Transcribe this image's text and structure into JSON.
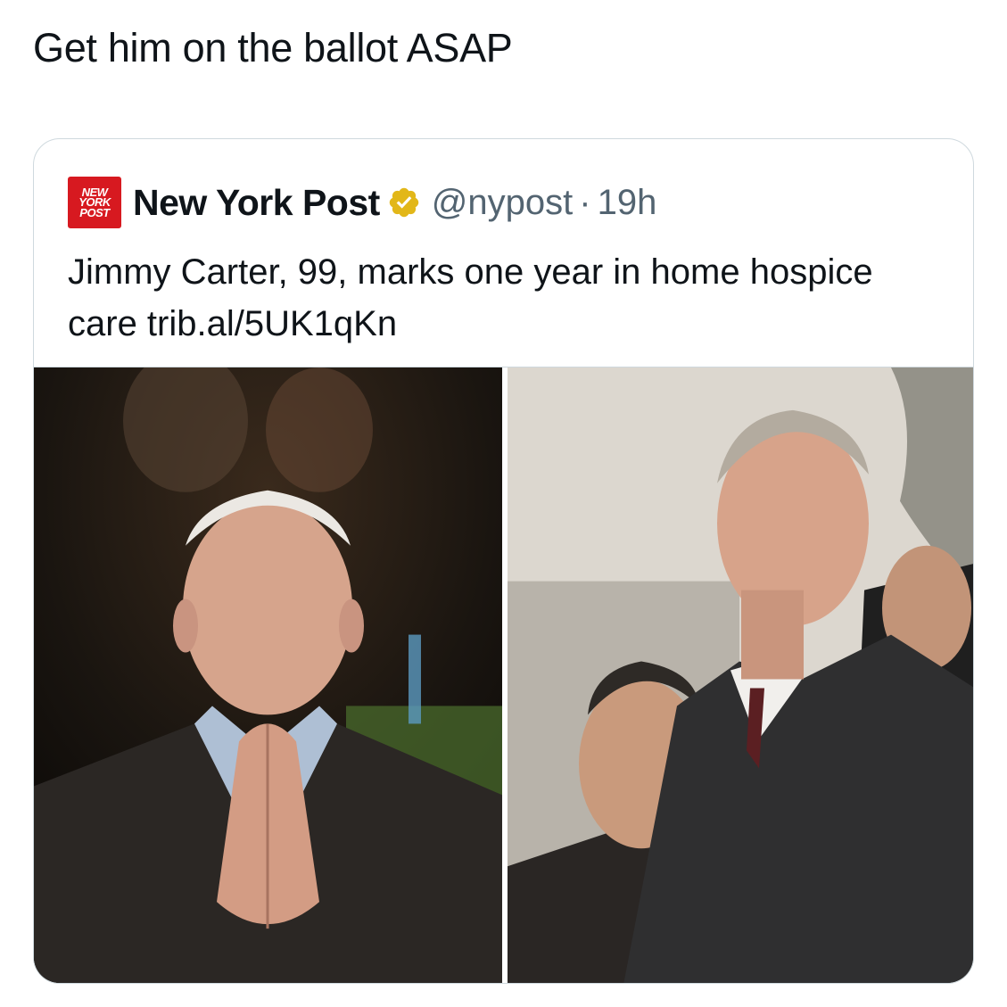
{
  "post": {
    "text": "Get him on the ballot ASAP"
  },
  "quote": {
    "logo_lines": [
      "NEW",
      "YORK",
      "POST"
    ],
    "author_name": "New York Post",
    "verified_icon": "verified-gold-badge-icon",
    "handle": "@nypost",
    "separator": "·",
    "time": "19h",
    "body": "Jimmy Carter, 99, marks one year in home hospice care trib.al/5UK1qKn",
    "media": [
      {
        "name": "photo-elderly-man-praying-hands"
      },
      {
        "name": "photo-two-men-standing-outdoors"
      }
    ]
  },
  "colors": {
    "text_primary": "#0f1419",
    "text_secondary": "#536471",
    "border": "#cfd9de",
    "verified_gold": "#e2b719",
    "brand_red": "#d71920"
  }
}
